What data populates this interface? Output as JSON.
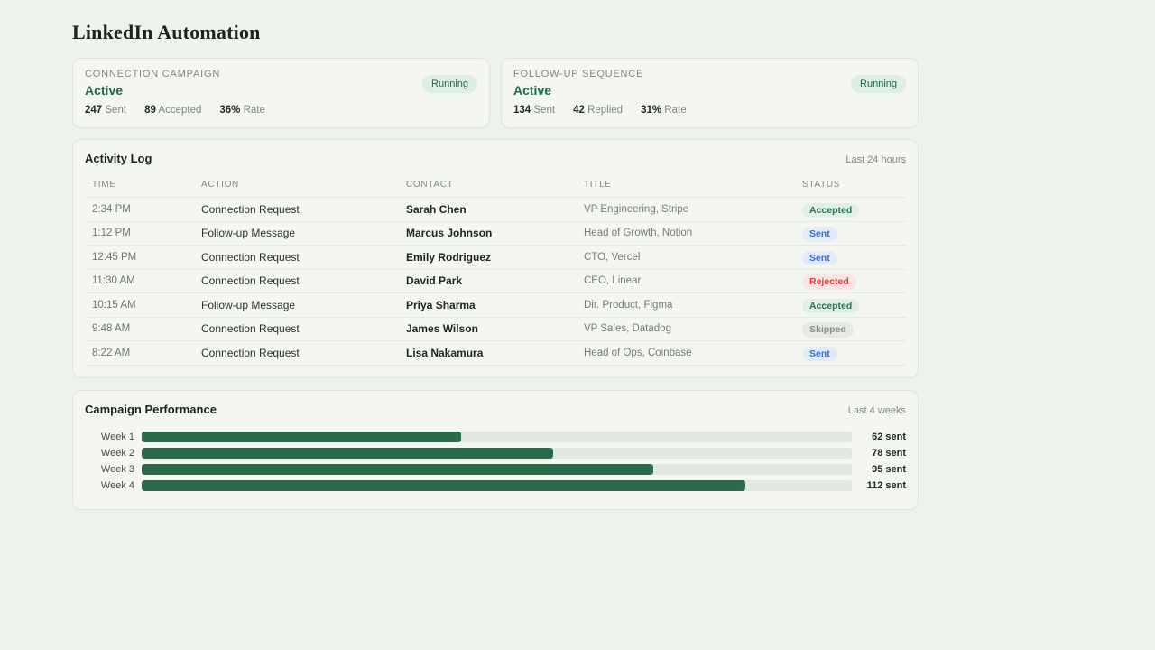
{
  "page": {
    "title": "LinkedIn Automation"
  },
  "colors": {
    "page_bg": "#eef2ed",
    "card_bg": "#f4f6f2",
    "accent_green": "#1d6b45",
    "bar_green": "#2d6a4c",
    "status_accepted": "#1a7a4a",
    "status_sent": "#2f6fd6",
    "status_rejected": "#e13b3b",
    "status_skipped": "#888e87"
  },
  "campaign_cards": [
    {
      "kicker": "CONNECTION CAMPAIGN",
      "state": "Active",
      "badge": "Running",
      "stats": [
        {
          "value": "247",
          "label": "Sent"
        },
        {
          "value": "89",
          "label": "Accepted"
        },
        {
          "value": "36%",
          "label": "Rate"
        }
      ]
    },
    {
      "kicker": "FOLLOW-UP SEQUENCE",
      "state": "Active",
      "badge": "Running",
      "stats": [
        {
          "value": "134",
          "label": "Sent"
        },
        {
          "value": "42",
          "label": "Replied"
        },
        {
          "value": "31%",
          "label": "Rate"
        }
      ]
    }
  ],
  "activity_log": {
    "title": "Activity Log",
    "range": "Last 24 hours",
    "columns": [
      "TIME",
      "ACTION",
      "CONTACT",
      "TITLE",
      "STATUS"
    ],
    "rows": [
      {
        "time": "2:34 PM",
        "action": "Connection Request",
        "contact": "Sarah Chen",
        "title": "VP Engineering, Stripe",
        "status": "Accepted",
        "status_type": "accepted"
      },
      {
        "time": "1:12 PM",
        "action": "Follow-up Message",
        "contact": "Marcus Johnson",
        "title": "Head of Growth, Notion",
        "status": "Sent",
        "status_type": "sent"
      },
      {
        "time": "12:45 PM",
        "action": "Connection Request",
        "contact": "Emily Rodriguez",
        "title": "CTO, Vercel",
        "status": "Sent",
        "status_type": "sent"
      },
      {
        "time": "11:30 AM",
        "action": "Connection Request",
        "contact": "David Park",
        "title": "CEO, Linear",
        "status": "Rejected",
        "status_type": "rejected"
      },
      {
        "time": "10:15 AM",
        "action": "Follow-up Message",
        "contact": "Priya Sharma",
        "title": "Dir. Product, Figma",
        "status": "Accepted",
        "status_type": "accepted"
      },
      {
        "time": "9:48 AM",
        "action": "Connection Request",
        "contact": "James Wilson",
        "title": "VP Sales, Datadog",
        "status": "Skipped",
        "status_type": "skipped"
      },
      {
        "time": "8:22 AM",
        "action": "Connection Request",
        "contact": "Lisa Nakamura",
        "title": "Head of Ops, Coinbase",
        "status": "Sent",
        "status_type": "sent"
      }
    ]
  },
  "performance": {
    "title": "Campaign Performance",
    "range": "Last 4 weeks",
    "chart_data": {
      "type": "bar",
      "orientation": "horizontal",
      "categories": [
        "Week 1",
        "Week 2",
        "Week 3",
        "Week 4"
      ],
      "values": [
        62,
        78,
        95,
        112
      ],
      "value_labels": [
        "62 sent",
        "78 sent",
        "95 sent",
        "112 sent"
      ],
      "bar_pct": [
        45,
        58,
        72,
        85
      ],
      "bar_color": "#2d6a4c",
      "track_color": "#e2e7df",
      "xlim": [
        0,
        132
      ],
      "grid": false,
      "legend": false
    }
  }
}
